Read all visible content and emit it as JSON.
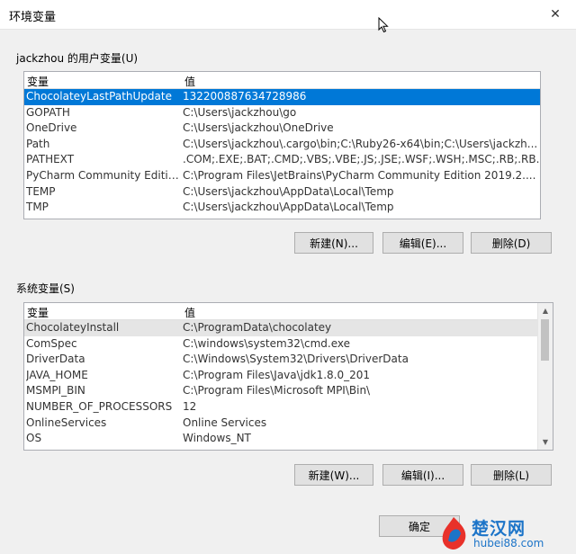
{
  "window": {
    "title": "环境变量",
    "close_label": "✕"
  },
  "user_vars": {
    "label": "jackzhou 的用户变量(U)",
    "headers": {
      "var": "变量",
      "val": "值"
    },
    "rows": [
      {
        "var": "ChocolateyLastPathUpdate",
        "val": "132200887634728986"
      },
      {
        "var": "GOPATH",
        "val": "C:\\Users\\jackzhou\\go"
      },
      {
        "var": "OneDrive",
        "val": "C:\\Users\\jackzhou\\OneDrive"
      },
      {
        "var": "Path",
        "val": "C:\\Users\\jackzhou\\.cargo\\bin;C:\\Ruby26-x64\\bin;C:\\Users\\jackzh..."
      },
      {
        "var": "PATHEXT",
        "val": ".COM;.EXE;.BAT;.CMD;.VBS;.VBE;.JS;.JSE;.WSF;.WSH;.MSC;.RB;.RB..."
      },
      {
        "var": "PyCharm Community Edition",
        "val": "C:\\Program Files\\JetBrains\\PyCharm Community Edition 2019.2...."
      },
      {
        "var": "TEMP",
        "val": "C:\\Users\\jackzhou\\AppData\\Local\\Temp"
      },
      {
        "var": "TMP",
        "val": "C:\\Users\\jackzhou\\AppData\\Local\\Temp"
      }
    ],
    "buttons": {
      "new": "新建(N)...",
      "edit": "编辑(E)...",
      "delete": "删除(D)"
    }
  },
  "system_vars": {
    "label": "系统变量(S)",
    "headers": {
      "var": "变量",
      "val": "值"
    },
    "rows": [
      {
        "var": "ChocolateyInstall",
        "val": "C:\\ProgramData\\chocolatey"
      },
      {
        "var": "ComSpec",
        "val": "C:\\windows\\system32\\cmd.exe"
      },
      {
        "var": "DriverData",
        "val": "C:\\Windows\\System32\\Drivers\\DriverData"
      },
      {
        "var": "JAVA_HOME",
        "val": "C:\\Program Files\\Java\\jdk1.8.0_201"
      },
      {
        "var": "MSMPI_BIN",
        "val": "C:\\Program Files\\Microsoft MPI\\Bin\\"
      },
      {
        "var": "NUMBER_OF_PROCESSORS",
        "val": "12"
      },
      {
        "var": "OnlineServices",
        "val": "Online Services"
      },
      {
        "var": "OS",
        "val": "Windows_NT"
      }
    ],
    "buttons": {
      "new": "新建(W)...",
      "edit": "编辑(I)...",
      "delete": "删除(L)"
    }
  },
  "footer": {
    "ok": "确定"
  },
  "watermark": {
    "text": "楚汉网",
    "url": "hubei88.com"
  },
  "colors": {
    "selection": "#0078d7",
    "watermark": "#1c74c8",
    "watermark_logo": "#e8312a"
  }
}
